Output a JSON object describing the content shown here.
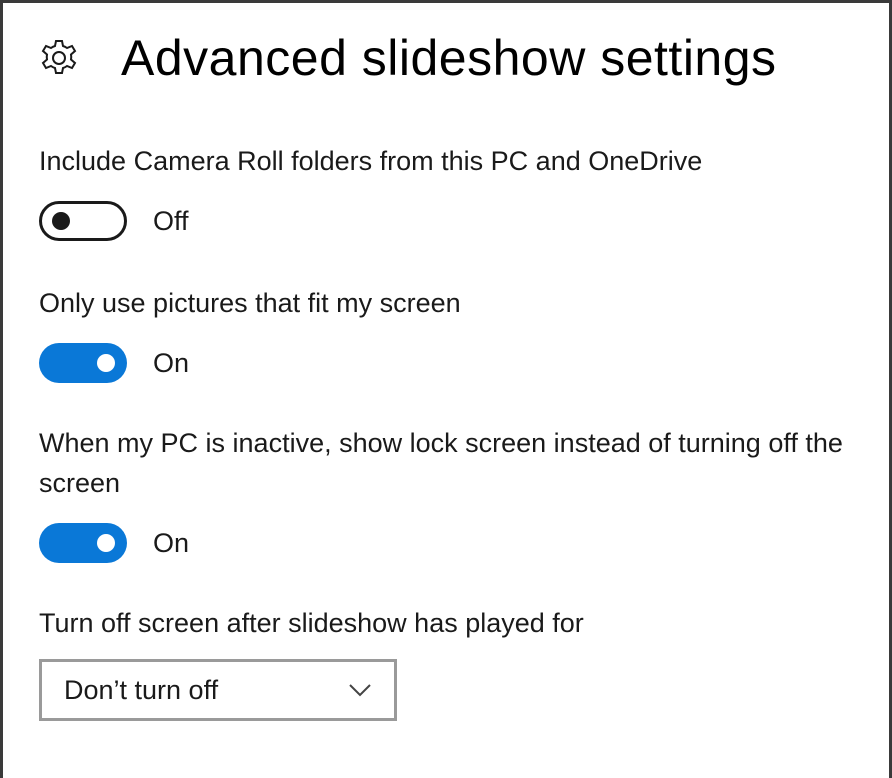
{
  "header": {
    "icon": "gear-icon",
    "title": "Advanced slideshow settings"
  },
  "settings": [
    {
      "label": "Include Camera Roll folders from this PC and OneDrive",
      "state": "Off",
      "on": false
    },
    {
      "label": "Only use pictures that fit my screen",
      "state": "On",
      "on": true
    },
    {
      "label": "When my PC is inactive, show lock screen instead of turning off the screen",
      "state": "On",
      "on": true
    }
  ],
  "turn_off": {
    "label": "Turn off screen after slideshow has played for",
    "selected": "Don’t turn off",
    "icon": "chevron-down-icon"
  },
  "colors": {
    "accent": "#0a78d7",
    "toggle_off": "#1a1a1a",
    "text": "#1a1a1a"
  }
}
